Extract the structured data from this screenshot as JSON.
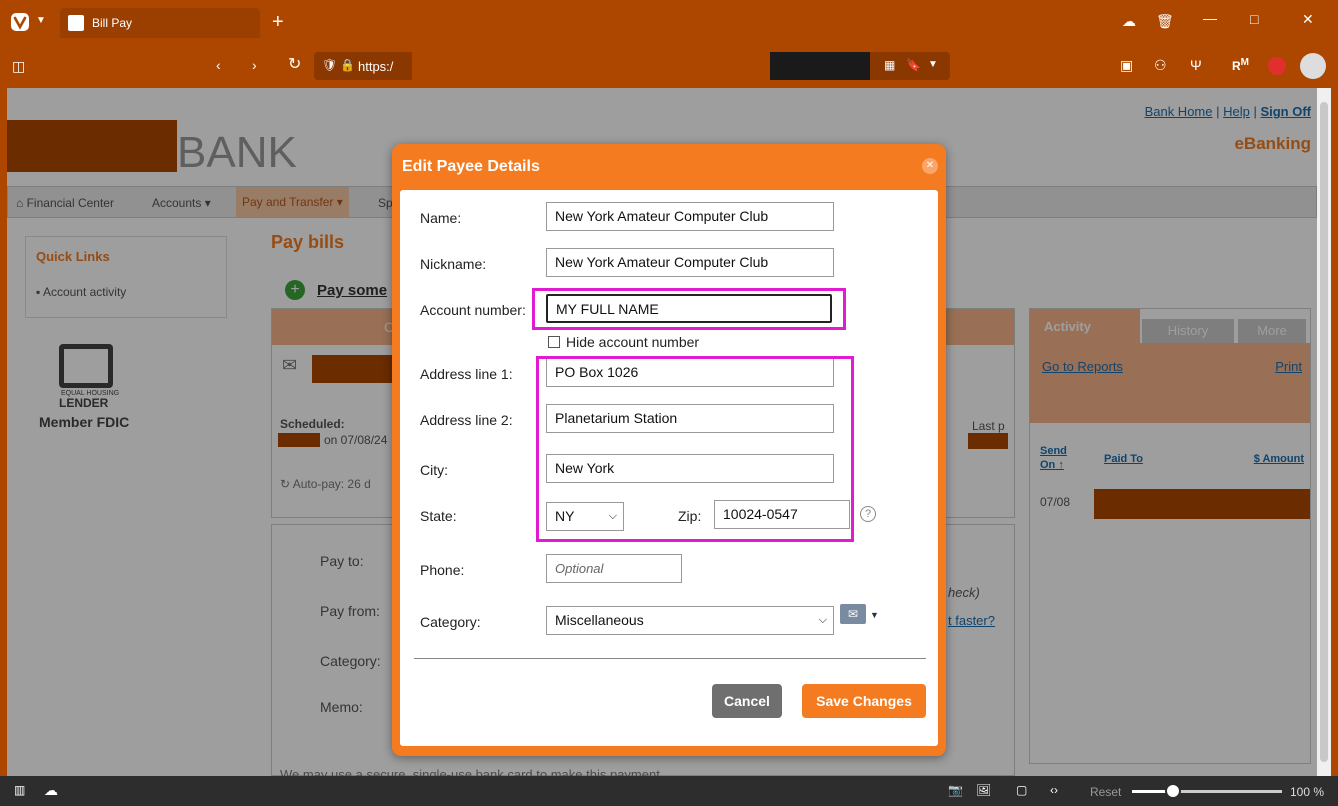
{
  "browser": {
    "tab_title": "Bill Pay",
    "address_prefix": "https:/",
    "zoom_reset_label": "Reset",
    "zoom_level": "100 %",
    "zoom_slider_fraction": 0.27
  },
  "site": {
    "brand_text": "BANK",
    "header_links": [
      "Bank Home",
      "Help",
      "Sign Off"
    ],
    "ebanking_label": "eBanking",
    "nav": [
      "Financial Center",
      "Accounts",
      "Pay and Transfer",
      "Sp"
    ],
    "quick_links_title": "Quick Links",
    "quick_links_items": [
      "Account activity"
    ],
    "equal_housing_small": "EQUAL HOUSING",
    "lender_text": "LENDER",
    "fdic_text": "Member FDIC",
    "pay_bills_title": "Pay bills",
    "pay_someone_text": "Pay some",
    "payee_header_letter": "C",
    "scheduled_label": "Scheduled:",
    "scheduled_date": "on 07/08/24",
    "autopay_text": "Auto-pay: 26 d",
    "form_labels": [
      "Pay to:",
      "Pay from:",
      "Category:",
      "Memo:"
    ],
    "check_text": "heck)",
    "faster_text": "t faster?",
    "last_text": "Last p",
    "bottom_note": "We may use a secure, single-use bank card to make this payment.",
    "tabs": [
      "Activity",
      "History",
      "More"
    ],
    "go_reports": "Go to Reports",
    "print_label": "Print",
    "col_send": "Send",
    "col_on": "On",
    "col_paid_to": "Paid To",
    "col_amount": "$ Amount",
    "row_date": "07/08"
  },
  "modal": {
    "title": "Edit Payee Details",
    "name_label": "Name:",
    "name_value": "New York Amateur Computer Club",
    "nickname_label": "Nickname:",
    "nickname_value": "New York Amateur Computer Club",
    "account_label": "Account number:",
    "account_value": "MY FULL NAME",
    "hide_account_label": "Hide account number",
    "address1_label": "Address line 1:",
    "address1_value": "PO Box 1026",
    "address2_label": "Address line 2:",
    "address2_value": "Planetarium Station",
    "city_label": "City:",
    "city_value": "New York",
    "state_label": "State:",
    "state_value": "NY",
    "zip_label": "Zip:",
    "zip_value": "10024-0547",
    "phone_label": "Phone:",
    "phone_placeholder": "Optional",
    "category_label": "Category:",
    "category_value": "Miscellaneous",
    "cancel_label": "Cancel",
    "save_label": "Save Changes"
  },
  "colors": {
    "browser_accent": "#ad4700",
    "modal_orange": "#f47b20",
    "highlight_magenta": "#e11bd0",
    "cancel_gray": "#6f6f6f"
  }
}
